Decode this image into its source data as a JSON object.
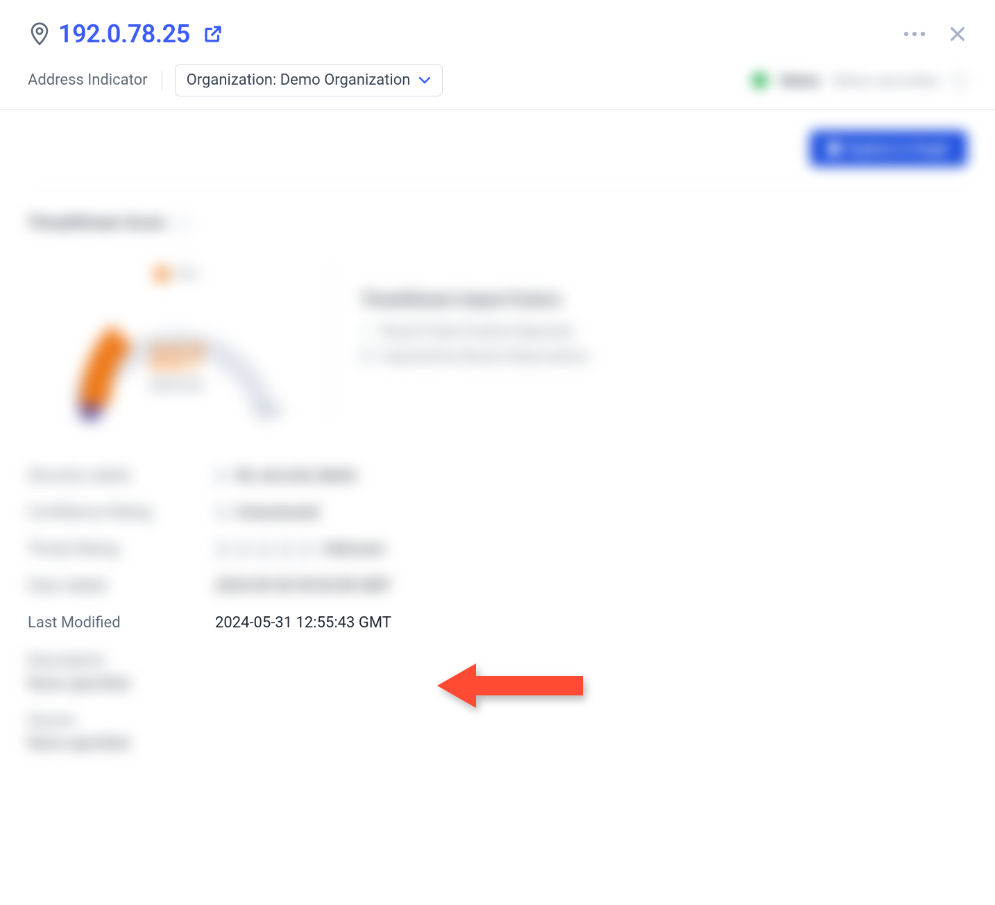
{
  "header": {
    "ip": "192.0.78.25",
    "subtitle": "Address Indicator",
    "organization_label": "Organization: Demo Organization",
    "status_primary": "Status",
    "status_secondary": "Status secondary"
  },
  "cta": {
    "label": "Explore in Graph"
  },
  "section": {
    "title": "ThreatStream Score"
  },
  "gauge": {
    "legend": "Hits",
    "value": "227",
    "sublabel": "MEDIUM",
    "min": "0",
    "max": "1000"
  },
  "factors": {
    "title": "ThreatStream Impact Factors",
    "items": [
      "Recent False Positive Reported",
      "Impacted by Recent Observations"
    ]
  },
  "details": {
    "row1_label": "Security Labels",
    "row1_value": "No security labels",
    "row2_label": "Confidence Rating",
    "row2_value": "Unassessed",
    "row3_label": "Threat Rating",
    "row3_value": "Unknown",
    "row4_label": "Date Added",
    "row4_value": "2024-05-30 09:04:58 GMT",
    "last_modified_label": "Last Modified",
    "last_modified_value": "2024-05-31 12:55:43 GMT",
    "desc_label": "Description",
    "desc_value": "None specified",
    "source_label": "Source",
    "source_value": "None specified"
  }
}
